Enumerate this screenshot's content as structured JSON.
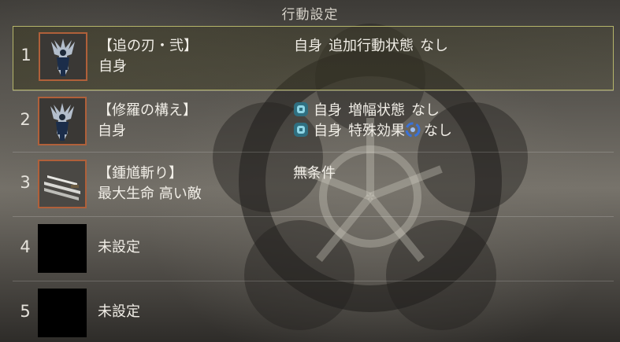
{
  "panel": {
    "title": "行動設定"
  },
  "slots": [
    {
      "number": "1",
      "icon": "demon-figure-icon",
      "name": "【追の刃・弐】",
      "target": "自身",
      "conditions": [
        {
          "subject": "自身",
          "state": "追加行動状態",
          "value": "なし",
          "gem": false,
          "swirl": false
        }
      ],
      "selected": true
    },
    {
      "number": "2",
      "icon": "demon-figure-icon",
      "name": "【修羅の構え】",
      "target": "自身",
      "conditions": [
        {
          "subject": "自身",
          "state": "増幅状態",
          "value": "なし",
          "gem": true,
          "swirl": false
        },
        {
          "subject": "自身",
          "state": "特殊効果",
          "value": "なし",
          "gem": true,
          "swirl": true
        }
      ],
      "selected": false
    },
    {
      "number": "3",
      "icon": "blade-slash-icon",
      "name": "【鍾馗斬り】",
      "target": "最大生命 高い敵",
      "conditions": [
        {
          "subject": "",
          "state": "無条件",
          "value": "",
          "gem": false,
          "swirl": false
        }
      ],
      "selected": false
    },
    {
      "number": "4",
      "icon": "empty-slot",
      "name": "",
      "target": "未設定",
      "conditions": [],
      "selected": false
    },
    {
      "number": "5",
      "icon": "empty-slot",
      "name": "",
      "target": "未設定",
      "conditions": [],
      "selected": false
    }
  ],
  "colors": {
    "selected_border": "#b5b56a",
    "icon_frame": "#b0603a",
    "gem": "#8fd6e6",
    "swirl": "#3a72d8"
  }
}
